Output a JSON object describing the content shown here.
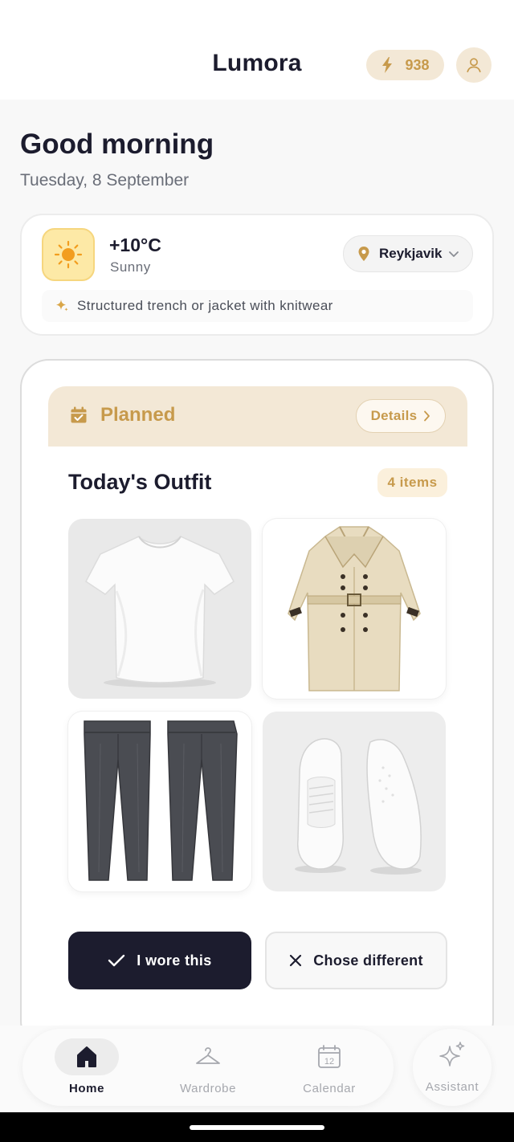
{
  "header": {
    "app_title": "Lumora",
    "credits": "938",
    "credits_icon": "lightning-icon",
    "profile_icon": "user-icon"
  },
  "greeting": {
    "title": "Good morning",
    "date": "Tuesday, 8 September"
  },
  "weather": {
    "icon": "sun-icon",
    "temperature": "+10°C",
    "condition": "Sunny",
    "location": "Reykjavik",
    "tip": "Structured trench or jacket with knitwear"
  },
  "outfit": {
    "status_label": "Planned",
    "details_label": "Details",
    "title": "Today's Outfit",
    "item_count": "4 items",
    "items": [
      {
        "name": "White T-shirt",
        "icon": "tshirt-image"
      },
      {
        "name": "Beige trench coat",
        "icon": "trench-coat-image"
      },
      {
        "name": "Grey trousers",
        "icon": "trousers-image"
      },
      {
        "name": "White sneakers",
        "icon": "sneakers-image"
      }
    ],
    "wore_label": "I wore this",
    "different_label": "Chose different"
  },
  "nav": {
    "items": [
      {
        "label": "Home",
        "icon": "home-icon",
        "active": true
      },
      {
        "label": "Wardrobe",
        "icon": "hanger-icon",
        "active": false
      },
      {
        "label": "Calendar",
        "icon": "calendar-icon",
        "active": false
      },
      {
        "label": "Assistant",
        "icon": "sparkle-icon",
        "active": false
      }
    ],
    "calendar_day": "12"
  },
  "colors": {
    "accent": "#c79a4c",
    "accent_bg": "#f3e8d6",
    "dark": "#1c1c2e",
    "sun": "#f29d1e"
  }
}
